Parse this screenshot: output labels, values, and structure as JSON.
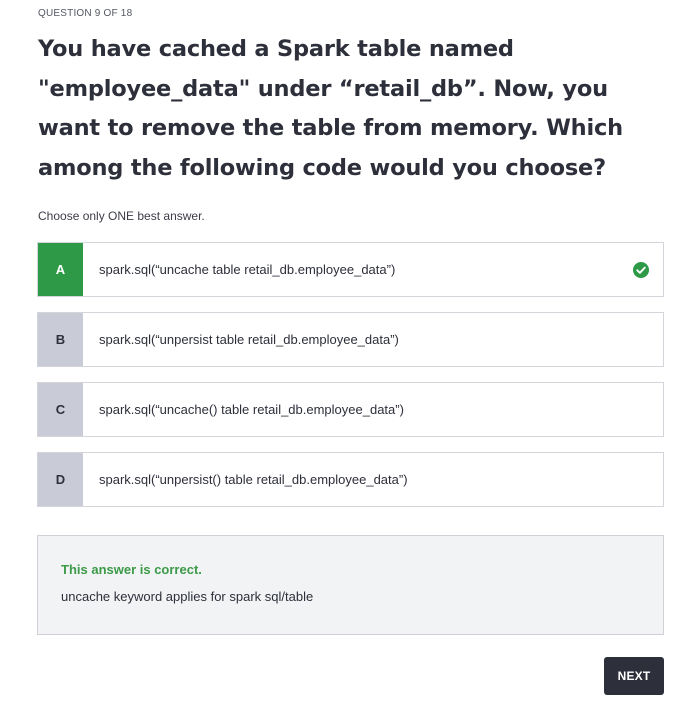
{
  "quiz": {
    "counter": "QUESTION 9 OF 18",
    "question": "You have cached a Spark table named \"employee_data\" under “retail_db”. Now, you want to remove the table from memory. Which among the following code would you choose?",
    "instruction": "Choose only ONE best answer."
  },
  "options": [
    {
      "letter": "A",
      "text": "spark.sql(“uncache table retail_db.employee_data”)",
      "state": "correct"
    },
    {
      "letter": "B",
      "text": "spark.sql(“unpersist table retail_db.employee_data”)",
      "state": "default"
    },
    {
      "letter": "C",
      "text": "spark.sql(“uncache() table retail_db.employee_data”)",
      "state": "default"
    },
    {
      "letter": "D",
      "text": "spark.sql(“unpersist() table retail_db.employee_data”)",
      "state": "default"
    }
  ],
  "feedback": {
    "title": "This answer is correct.",
    "explanation": "uncache keyword applies for spark sql/table"
  },
  "actions": {
    "next_label": "NEXT"
  },
  "colors": {
    "correct": "#2e9a47",
    "letter_bg": "#c9ccd6",
    "text": "#2d2f3a",
    "feedback_title": "#3c9a48",
    "button_bg": "#2d2f3a"
  },
  "icons": {
    "correct_check": "check-circle-icon"
  }
}
